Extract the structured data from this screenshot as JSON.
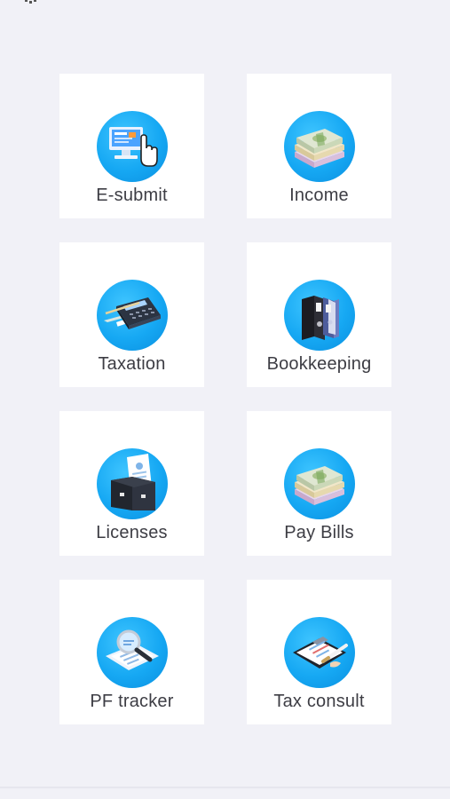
{
  "colors": {
    "background": "#f1f1f7",
    "tile": "#ffffff",
    "icon_circle": "#16a8f3",
    "label": "#3d3d44"
  },
  "tiles": [
    {
      "label": "E-submit",
      "icon": "computer-click-icon"
    },
    {
      "label": "Income",
      "icon": "money-stack-icon"
    },
    {
      "label": "Taxation",
      "icon": "calculator-icon"
    },
    {
      "label": "Bookkeeping",
      "icon": "binders-icon"
    },
    {
      "label": "Licenses",
      "icon": "briefcase-document-icon"
    },
    {
      "label": "Pay Bills",
      "icon": "money-stack-icon"
    },
    {
      "label": "PF tracker",
      "icon": "magnifier-document-icon"
    },
    {
      "label": "Tax consult",
      "icon": "clipboard-pen-icon"
    }
  ]
}
